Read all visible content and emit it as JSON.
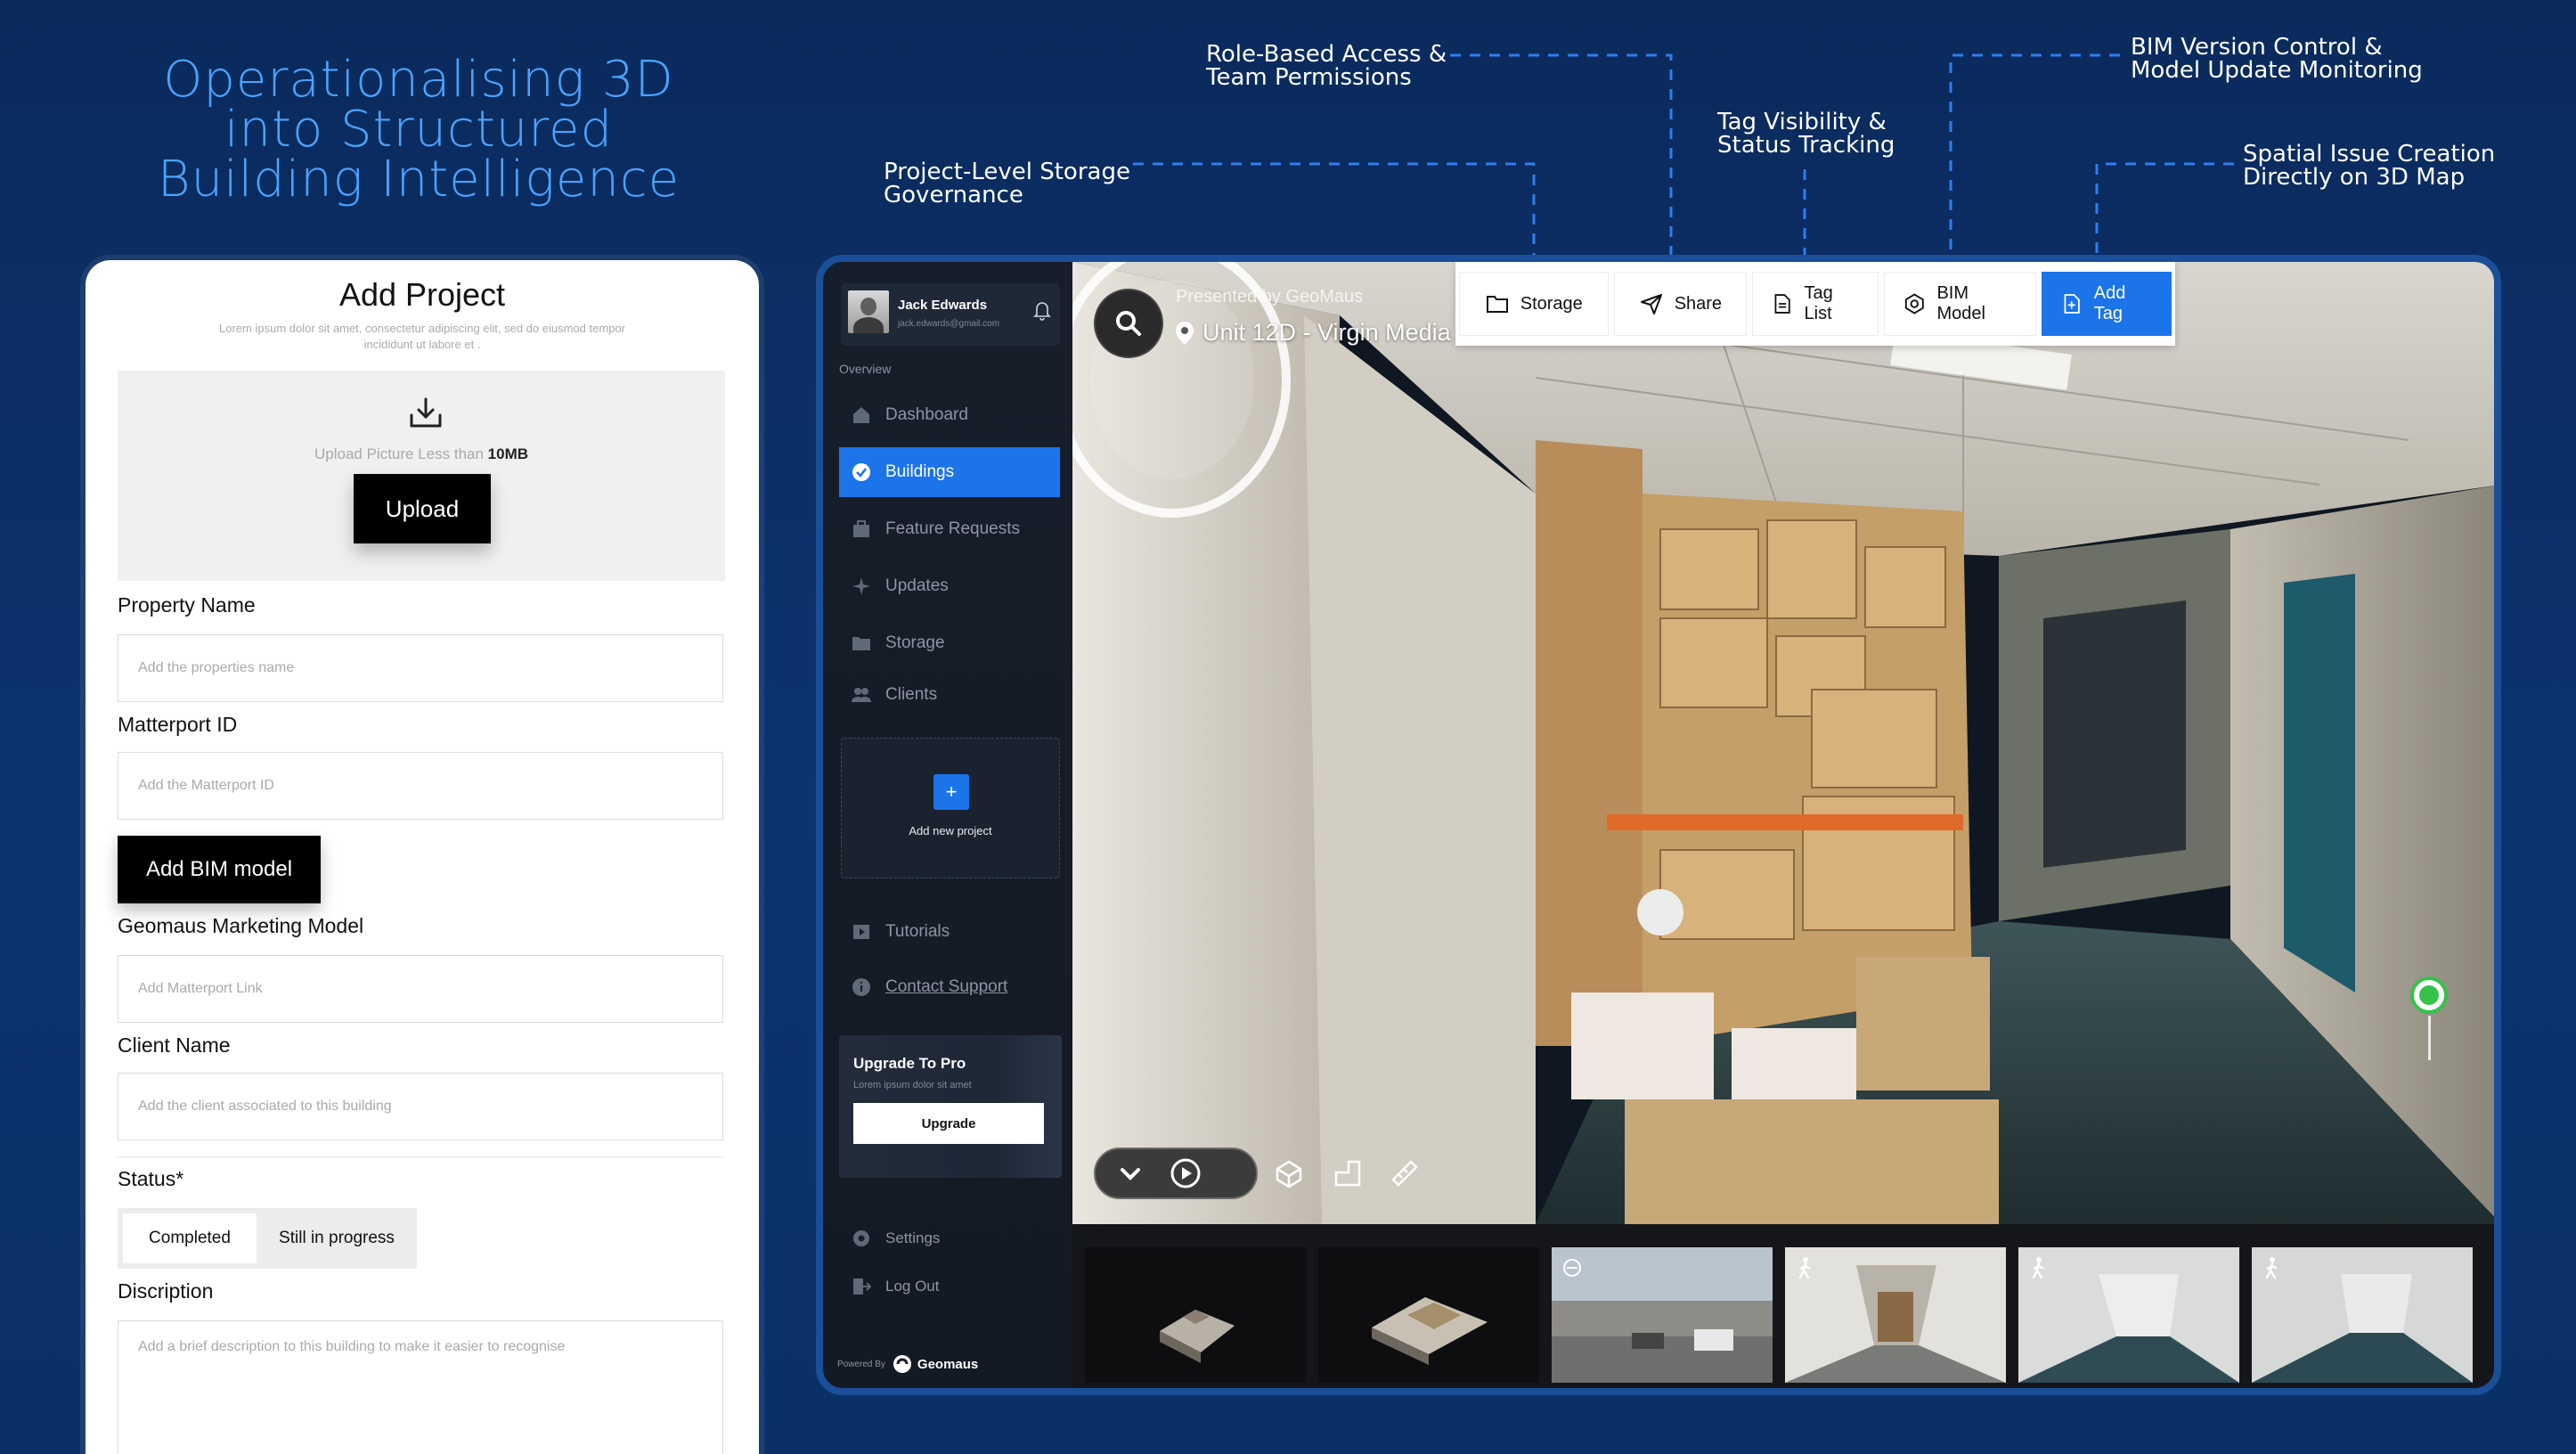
{
  "headline": "Operationalising 3D\ninto Structured\nBuilding Intelligence",
  "callouts": {
    "storage": "Project-Level Storage\nGovernance",
    "access": "Role-Based Access &\nTeam Permissions",
    "tags": "Tag Visibility &\nStatus Tracking",
    "bim": "BIM Version Control &\nModel Update Monitoring",
    "spatial": "Spatial Issue Creation\nDirectly on 3D Map"
  },
  "form": {
    "title": "Add Project",
    "subtitle": "Lorem ipsum dolor sit amet, consectetur adipiscing elit, sed do eiusmod tempor incididunt ut labore et .",
    "upload_hint_prefix": "Upload  Picture Less than ",
    "upload_hint_size": "10MB",
    "upload_button": "Upload",
    "property_name": {
      "label": "Property Name",
      "placeholder": "Add the properties name"
    },
    "matterport_id": {
      "label": "Matterport ID",
      "placeholder": "Add the Matterport ID"
    },
    "add_bim_button": "Add BIM model",
    "marketing_model": {
      "label": "Geomaus Marketing Model",
      "placeholder": "Add Matterport Link"
    },
    "client_name": {
      "label": "Client Name",
      "placeholder": "Add the client associated to this building"
    },
    "status": {
      "label": "Status*",
      "options": [
        "Completed",
        "Still in progress"
      ],
      "selected": "Completed"
    },
    "description": {
      "label": "Discription",
      "placeholder": "Add a brief description to this building to make it easier to recognise"
    }
  },
  "sidebar": {
    "user": {
      "name": "Jack Edwards",
      "email": "jack.edwards@gmail.com"
    },
    "section": "Overview",
    "items": [
      {
        "label": "Dashboard",
        "icon": "home-icon"
      },
      {
        "label": "Buildings",
        "icon": "building-icon",
        "active": true
      },
      {
        "label": "Feature Requests",
        "icon": "briefcase-icon"
      },
      {
        "label": "Updates",
        "icon": "sparkle-icon"
      },
      {
        "label": "Storage",
        "icon": "folder-icon"
      },
      {
        "label": "Clients",
        "icon": "users-icon"
      }
    ],
    "add_project": "Add new project",
    "secondary": [
      {
        "label": "Tutorials",
        "icon": "video-icon"
      },
      {
        "label": "Contact Support",
        "icon": "info-icon"
      }
    ],
    "upgrade": {
      "title": "Upgrade To Pro",
      "subtitle": "Lorem ipsum dolor sit amet",
      "button": "Upgrade"
    },
    "footer": [
      {
        "label": "Settings",
        "icon": "gear-icon"
      },
      {
        "label": "Log Out",
        "icon": "logout-icon"
      }
    ],
    "powered_by": "Powered By",
    "brand": "Geomaus"
  },
  "viewer": {
    "presented_by": "Presented by GeoMaus",
    "location": "Unit 12D - Virgin Media",
    "toolbar": [
      {
        "label": "Storage",
        "icon": "folder-icon"
      },
      {
        "label": "Share",
        "icon": "send-icon"
      },
      {
        "label": "Tag List",
        "icon": "document-icon"
      },
      {
        "label": "BIM Model",
        "icon": "bim-icon"
      },
      {
        "label": "Add Tag",
        "icon": "add-document-icon",
        "primary": true
      }
    ]
  },
  "colors": {
    "accent": "#1b74ea",
    "background": "#0b2f68",
    "callout_line": "#2f7df0",
    "tag_pin": "#35c24a"
  }
}
